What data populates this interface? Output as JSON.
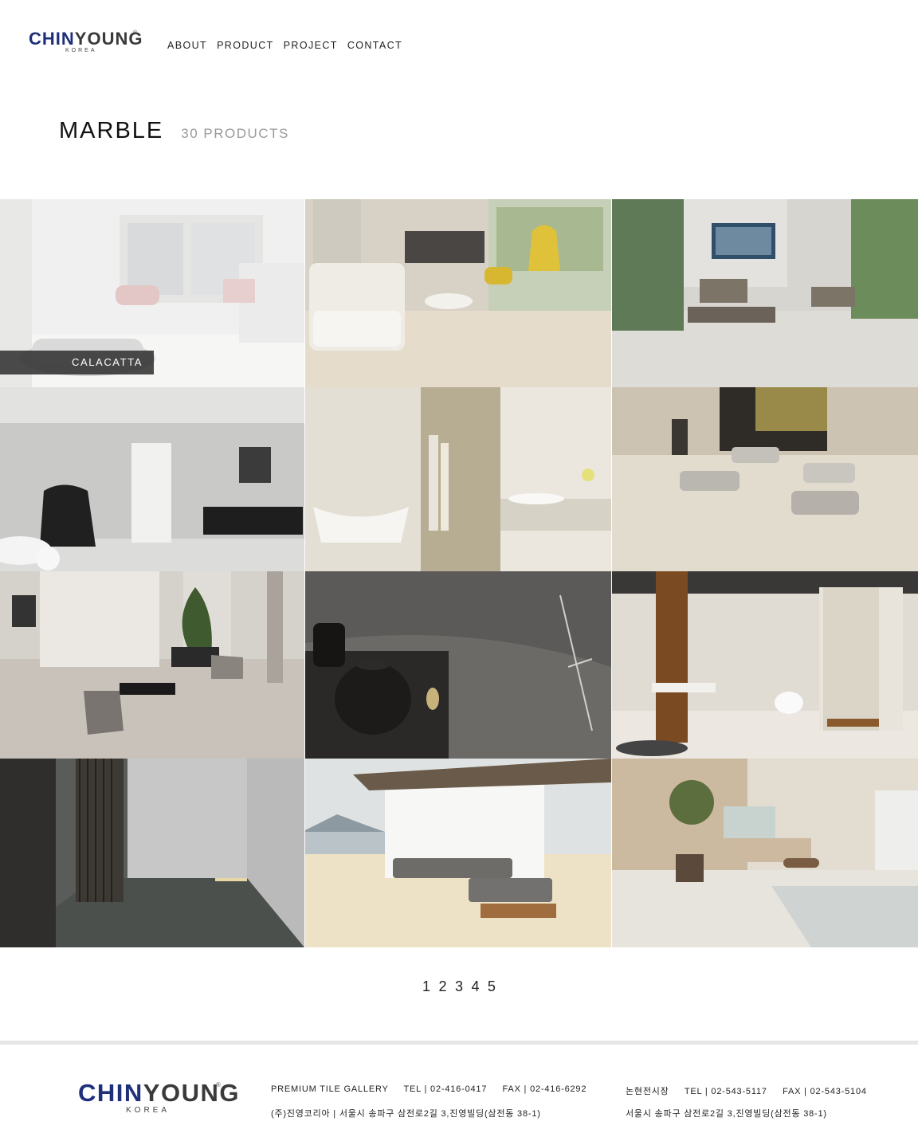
{
  "header": {
    "logo": {
      "brand_part1": "CHIN",
      "brand_part2": "YOUNG",
      "registered": "®",
      "subtitle": "KOREA"
    },
    "nav": [
      "ABOUT",
      "PRODUCT",
      "PROJECT",
      "CONTACT"
    ]
  },
  "category": {
    "title": "MARBLE",
    "count": "30 PRODUCTS"
  },
  "grid": {
    "hover_label": "CALACATTA",
    "tiles": [
      "living-room-white",
      "living-room-cream",
      "lobby-gray-sofas",
      "bathroom-gray-wall",
      "bathroom-beige",
      "lobby-benches",
      "lounge-plants",
      "dark-stone-teapot",
      "shower-room-beige",
      "corridor-dark",
      "terrace-lake",
      "indoor-pool"
    ]
  },
  "pagination": [
    "1",
    "2",
    "3",
    "4",
    "5"
  ],
  "footer": {
    "logo": {
      "brand_part1": "CHIN",
      "brand_part2": "YOUNG",
      "registered": "®",
      "subtitle": "KOREA"
    },
    "gallery_line": "PREMIUM TILE GALLERY     TEL | 02-416-0417     FAX | 02-416-6292",
    "gallery_address": "(주)진영코리아 | 서울시 송파구 삼전로2길 3,진영빌딩(삼전동 38-1)",
    "showroom_line": "논현전시장     TEL | 02-543-5117     FAX | 02-543-5104",
    "showroom_address": "서울시 송파구 삼전로2길 3,진영빌딩(삼전동 38-1)"
  }
}
